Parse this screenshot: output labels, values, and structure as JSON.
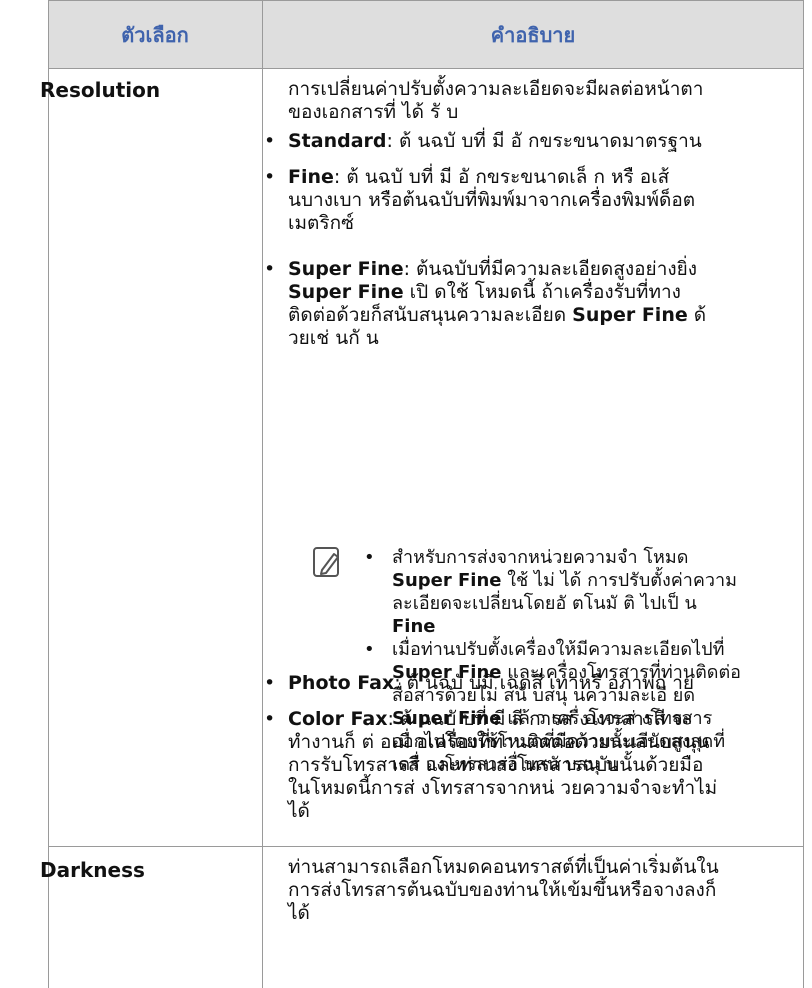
{
  "header": {
    "col_option": "ตัวเลือก",
    "col_description": "คำอธิบาย"
  },
  "rows": {
    "resolution": {
      "label": "Resolution",
      "intro": "การเปลี่ยนค่าปรับตั้งความละเอียดจะมีผลต่อหน้าตาของเอกสารที่ ได้ รั บ",
      "items": {
        "standard": {
          "name": "Standard",
          "text": ": ต้ นฉบั บที่ มี อั กขระขนาดมาตรฐาน"
        },
        "fine": {
          "name": "Fine",
          "text": ": ต้ นฉบั บที่ มี อั กขระขนาดเล็ ก หรื อเส้ นบางเบา หรือต้นฉบับที่พิมพ์มาจากเครื่องพิมพ์ด็อตเมตริกซ์"
        },
        "superfine": {
          "name": "Super Fine",
          "text": ": ต้นฉบับที่มีความละเอียดสูงอย่างยิ่ง",
          "line2_name": "Super Fine",
          "line2_text": " เปิ ดใช้ โหมดนี้ ถ้าเครื่องรับที่ทางติดต่อด้วยก็สนับสนุนความละเอียด",
          "line3_name": "Super Fine",
          "line3_text": " ด้ วยเช่ นกั น"
        },
        "photo": {
          "name": "Photo Fax",
          "text": ": ต้ นฉบั บมี เฉดสี เทาหรื อภาพถ่ าย"
        },
        "color": {
          "name": "Color Fax",
          "text": ": ต้ นฉบั บที่ มี สี การส่ งโทรสารสี จะทำงานก็ ต่ อเมื่ อเครื่องที่ท่านติดต่อด้วยนั้นสนับสนุนการรับโทรสารสี และท่านส่งโทรสารฉบับนั้นด้วยมือ ในโหมดนี้การส่ งโทรสารจากหน่ วยความจำจะทำไม่ ได้"
        }
      },
      "notes": {
        "n1_a": "สำหรับการส่งจากหน่วยความจำ โหมด",
        "n1_name": "Super Fine",
        "n1_b": " ใช้ ไม่ ได้ การปรับตั้งค่าความละเอียดจะเปลี่ยนโดยอั ตโนมั ติ ไปเป็ น",
        "n1_name2": "Fine",
        "n2_a": "เมื่อท่านปรับตั้งเครื่องให้มีความละเอียดไปที่",
        "n2_name": "Super Fine",
        "n2_b": " และเครื่องโทรสารที่ท่านติดต่อสื่อสารด้วยไม่ สนั บสนุ นความละเอี ยด",
        "n2_name2": "Super Fine",
        "n2_c": " แล้ ว เครื่ องจะส่ งโทรสารออกไปโดยใช้โหมดที่มีความละเอียดสูงสุดที่เครื่ องโทรสารอื่ นสนั บสนุ น"
      }
    },
    "darkness": {
      "label": "Darkness",
      "text": "ท่านสามารถเลือกโหมดคอนทราสต์ที่เป็นค่าเริ่มต้นในการส่งโทรสารต้นฉบับของท่านให้เข้มขึ้นหรือจางลงก็ ได้"
    }
  },
  "icons": {
    "note": "note-pencil-icon",
    "bullet": "•"
  },
  "colors": {
    "header_bg": "#dedede",
    "header_text": "#3f63ad",
    "border": "#9a9a9a"
  }
}
